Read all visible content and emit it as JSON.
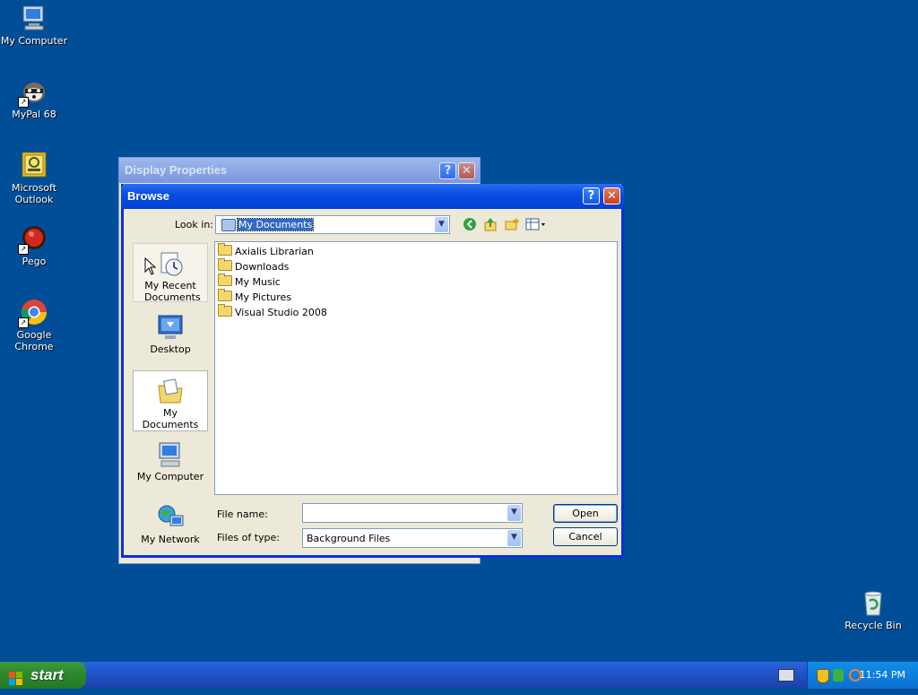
{
  "desktop": {
    "icons": [
      {
        "label": "My Computer"
      },
      {
        "label": "MyPal 68"
      },
      {
        "label": "Microsoft Outlook"
      },
      {
        "label": "Pego"
      },
      {
        "label": "Google Chrome"
      },
      {
        "label": "Recycle Bin"
      }
    ]
  },
  "display_properties": {
    "title": "Display Properties"
  },
  "browse": {
    "title": "Browse",
    "look_in_label": "Look in:",
    "look_in_value": "My Documents",
    "places": [
      {
        "label": "My Recent Documents"
      },
      {
        "label": "Desktop"
      },
      {
        "label": "My Documents"
      },
      {
        "label": "My Computer"
      },
      {
        "label": "My Network"
      }
    ],
    "files": [
      "Axialis Librarian",
      "Downloads",
      "My Music",
      "My Pictures",
      "Visual Studio 2008"
    ],
    "file_name_label": "File name:",
    "file_name_value": "",
    "file_type_label": "Files of type:",
    "file_type_value": "Background Files",
    "open_label": "Open",
    "cancel_label": "Cancel"
  },
  "taskbar": {
    "start_label": "start",
    "clock": "11:54 PM"
  }
}
